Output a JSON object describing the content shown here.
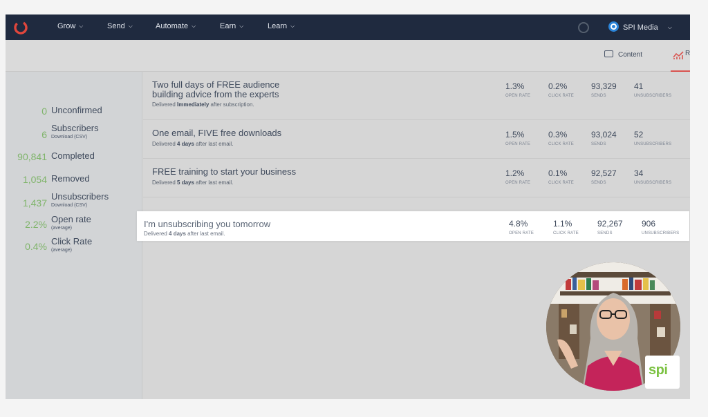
{
  "nav": {
    "items": [
      {
        "label": "Grow"
      },
      {
        "label": "Send"
      },
      {
        "label": "Automate"
      },
      {
        "label": "Earn"
      },
      {
        "label": "Learn"
      }
    ],
    "account": "SPI Media",
    "chevron": "⌄"
  },
  "toolbar": {
    "content_label": "Content",
    "reports_cut_label": "R"
  },
  "sidebar": {
    "stats": [
      {
        "value": "0",
        "label": "Unconfirmed",
        "sub": ""
      },
      {
        "value": "6",
        "label": "Subscribers",
        "sub": "Download (CSV)"
      },
      {
        "value": "90,841",
        "label": "Completed",
        "sub": ""
      },
      {
        "value": "1,054",
        "label": "Removed",
        "sub": ""
      },
      {
        "value": "1,437",
        "label": "Unsubscribers",
        "sub": "Download (CSV)"
      },
      {
        "value": "2.2%",
        "label": "Open rate",
        "sub": "(average)"
      },
      {
        "value": "0.4%",
        "label": "Click Rate",
        "sub": "(average)"
      }
    ]
  },
  "metric_labels": {
    "open": "OPEN RATE",
    "click": "CLICK RATE",
    "sends": "SENDS",
    "unsub": "UNSUBSCRIBERS"
  },
  "emails": [
    {
      "subject": "Two full days of FREE audience building advice from the experts",
      "delivered_prefix": "Delivered",
      "delivered_bold": "Immediately",
      "delivered_suffix": "after subscription.",
      "open_rate": "1.3%",
      "click_rate": "0.2%",
      "sends": "93,329",
      "unsubscribers": "41"
    },
    {
      "subject": "One email, FIVE free downloads",
      "delivered_prefix": "Delivered",
      "delivered_bold": "4 days",
      "delivered_suffix": "after last email.",
      "open_rate": "1.5%",
      "click_rate": "0.3%",
      "sends": "93,024",
      "unsubscribers": "52"
    },
    {
      "subject": "FREE training to start your business",
      "delivered_prefix": "Delivered",
      "delivered_bold": "5 days",
      "delivered_suffix": "after last email.",
      "open_rate": "1.2%",
      "click_rate": "0.1%",
      "sends": "92,527",
      "unsubscribers": "34"
    },
    {
      "subject": "I'm unsubscribing you tomorrow",
      "delivered_prefix": "Delivered",
      "delivered_bold": "4 days",
      "delivered_suffix": "after last email.",
      "open_rate": "4.8%",
      "click_rate": "1.1%",
      "sends": "92,267",
      "unsubscribers": "906"
    }
  ],
  "overlay": {
    "logo_text": "spi"
  },
  "colors": {
    "nav_bg": "#1f2a3f",
    "stat_green": "#7fb46a",
    "accent_red": "#d9534f",
    "power_blue": "#2b84d8",
    "spi_green": "#7cc242"
  }
}
